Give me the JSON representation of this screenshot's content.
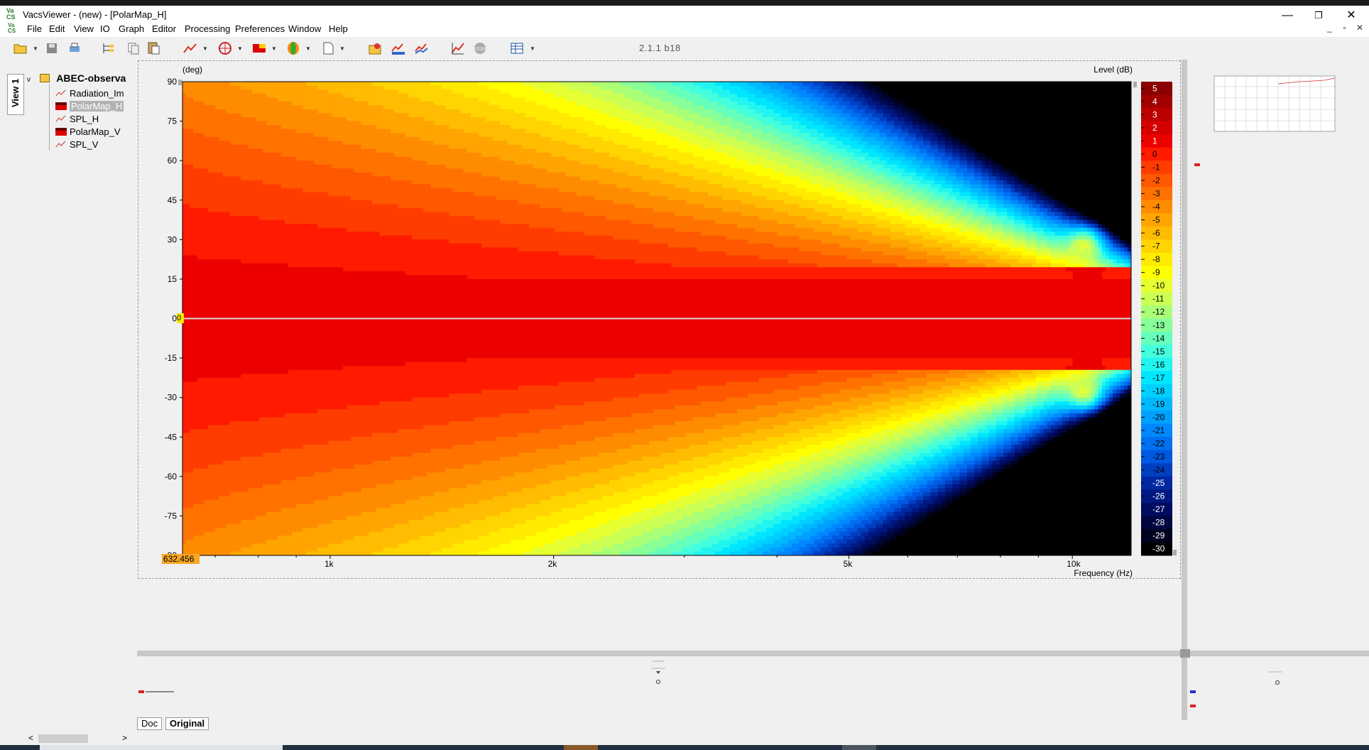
{
  "window": {
    "title": "VacsViewer - (new) - [PolarMap_H]",
    "logo_text": "VaCS"
  },
  "window_controls": {
    "minimize": "—",
    "restore": "❐",
    "close": "✕"
  },
  "mdi_controls": {
    "minimize": "_",
    "restore": "▫",
    "close": "✕"
  },
  "menu": [
    "File",
    "Edit",
    "View",
    "IO",
    "Graph",
    "Editor",
    "Processing",
    "Preferences",
    "Window",
    "Help"
  ],
  "toolbar": {
    "version": "2.1.1 b18"
  },
  "tree": {
    "tab_label": "View 1",
    "root_label": "ABEC-observa",
    "items": [
      {
        "label": "Radiation_Im",
        "icon": "line-graph-icon"
      },
      {
        "label": "PolarMap_H",
        "icon": "polar-map-icon",
        "selected": true
      },
      {
        "label": "SPL_H",
        "icon": "line-graph-icon"
      },
      {
        "label": "PolarMap_V",
        "icon": "polar-map-icon"
      },
      {
        "label": "SPL_V",
        "icon": "line-graph-icon"
      }
    ]
  },
  "plot": {
    "y_unit_label": "(deg)",
    "colorbar_title": "Level  (dB)",
    "x_axis_label": "Frequency  (Hz)",
    "cursor_x_readout": "632.456",
    "cursor_y_readout": "0"
  },
  "chart_data": {
    "type": "heatmap",
    "title": "",
    "xlabel": "Frequency  (Hz)",
    "ylabel": "(deg)",
    "x_scale": "log",
    "xlim": [
      632.456,
      12000
    ],
    "ylim": [
      -90,
      90
    ],
    "x_ticks": [
      {
        "value": 1000,
        "label": "1k"
      },
      {
        "value": 2000,
        "label": "2k"
      },
      {
        "value": 5000,
        "label": "5k"
      },
      {
        "value": 10000,
        "label": "10k"
      }
    ],
    "y_ticks": [
      90,
      75,
      60,
      45,
      30,
      15,
      0,
      -15,
      -30,
      -45,
      -60,
      -75,
      -90
    ],
    "colorbar": {
      "label": "Level  (dB)",
      "min": -30,
      "max": 5,
      "ticks": [
        5,
        4,
        3,
        2,
        1,
        0,
        -1,
        -2,
        -3,
        -4,
        -5,
        -6,
        -7,
        -8,
        -9,
        -10,
        -11,
        -12,
        -13,
        -14,
        -15,
        -16,
        -17,
        -18,
        -19,
        -20,
        -21,
        -22,
        -23,
        -24,
        -25,
        -26,
        -27,
        -28,
        -29,
        -30
      ],
      "colors": [
        "#8b0000",
        "#a30000",
        "#bb0000",
        "#d40000",
        "#ec0000",
        "#ff1a00",
        "#ff3c00",
        "#ff5800",
        "#ff7200",
        "#ff8c00",
        "#ffa400",
        "#ffbc00",
        "#ffd400",
        "#ffea00",
        "#ffff00",
        "#e6ff33",
        "#ccff55",
        "#aaff77",
        "#88ff99",
        "#66ffbb",
        "#44ffdd",
        "#22f5f0",
        "#00e6ff",
        "#00d0ff",
        "#00b8ff",
        "#00a0ff",
        "#0088ff",
        "#0070f0",
        "#0058e0",
        "#0040c0",
        "#0028a0",
        "#001880",
        "#000c60",
        "#000640",
        "#000320",
        "#000000"
      ]
    },
    "contour_summary": "Level is near 0 dB on-axis across the band and falls off with angle; narrow beaming above 5 kHz, with a ridge near ±30° at about 10.5 kHz."
  },
  "doc_tabs": [
    {
      "label": "Doc",
      "active": false
    },
    {
      "label": "Original",
      "active": true
    }
  ],
  "scroll": {
    "left": "<",
    "right": ">"
  }
}
